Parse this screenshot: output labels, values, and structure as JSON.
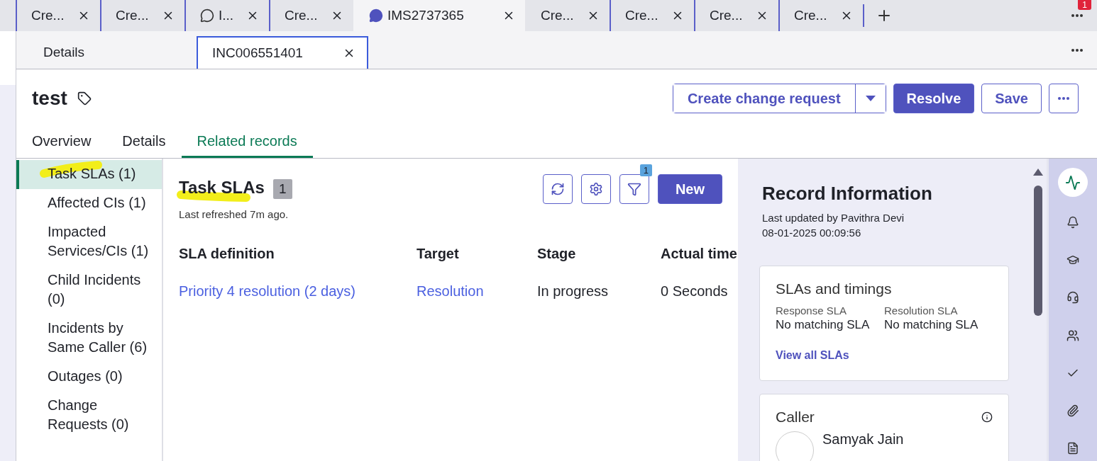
{
  "browser_tabs": [
    {
      "label": "Cre...",
      "kind": "plain",
      "selected": false
    },
    {
      "label": "Cre...",
      "kind": "plain",
      "selected": false
    },
    {
      "label": "I...",
      "kind": "chat",
      "selected": false
    },
    {
      "label": "Cre...",
      "kind": "plain",
      "selected": false
    },
    {
      "label": "IMS2737365",
      "kind": "chat",
      "selected": true
    },
    {
      "label": "Cre...",
      "kind": "plain",
      "selected": false
    },
    {
      "label": "Cre...",
      "kind": "plain",
      "selected": false
    },
    {
      "label": "Cre...",
      "kind": "plain",
      "selected": false
    },
    {
      "label": "Cre...",
      "kind": "plain",
      "selected": false
    }
  ],
  "notification_badge": "1",
  "record_tabs": [
    {
      "label": "Details",
      "selected": false,
      "closable": false
    },
    {
      "label": "INC006551401",
      "selected": true,
      "closable": true
    }
  ],
  "record": {
    "title": "test",
    "actions": [
      {
        "label": "Create change request",
        "kind": "split"
      },
      {
        "label": "Resolve",
        "kind": "primary"
      },
      {
        "label": "Save",
        "kind": "secondary"
      },
      {
        "kind": "more"
      }
    ]
  },
  "tabs": [
    {
      "label": "Overview",
      "selected": false
    },
    {
      "label": "Details",
      "selected": false
    },
    {
      "label": "Related records",
      "selected": true
    }
  ],
  "related_lists": [
    {
      "label": "Task SLAs (1)",
      "selected": true
    },
    {
      "label": "Affected CIs (1)",
      "selected": false
    },
    {
      "label": "Impacted Services/CIs (1)",
      "selected": false
    },
    {
      "label": "Child Incidents (0)",
      "selected": false
    },
    {
      "label": "Incidents by Same Caller (6)",
      "selected": false
    },
    {
      "label": "Outages (0)",
      "selected": false
    },
    {
      "label": "Change Requests (0)",
      "selected": false
    }
  ],
  "task_slas": {
    "title": "Task SLAs",
    "count": "1",
    "refreshed": "Last refreshed 7m ago.",
    "filter_count": "1",
    "new_button": "New",
    "columns": [
      "SLA definition",
      "Target",
      "Stage",
      "Actual time"
    ],
    "rows": [
      {
        "cells": [
          {
            "text": "Priority 4 resolution (2 days)",
            "link": true
          },
          {
            "text": "Resolution",
            "link": true
          },
          {
            "text": "In progress",
            "link": false
          },
          {
            "text": "0 Seconds",
            "link": false
          }
        ]
      }
    ]
  },
  "record_information": {
    "title": "Record Information",
    "updated_by": "Last updated by Pavithra Devi",
    "updated_at": "08-01-2025 00:09:56",
    "slas_card": {
      "title": "SLAs and timings",
      "fields": [
        {
          "label": "Response SLA",
          "value": "No matching SLA"
        },
        {
          "label": "Resolution SLA",
          "value": "No matching SLA"
        }
      ],
      "link": "View all SLAs"
    },
    "caller_card": {
      "title": "Caller",
      "name": "Samyak Jain"
    }
  },
  "rail": [
    {
      "kind": "activity",
      "selected": true
    },
    {
      "kind": "bell",
      "selected": false
    },
    {
      "kind": "cap",
      "selected": false
    },
    {
      "kind": "headset",
      "selected": false
    },
    {
      "kind": "users",
      "selected": false
    },
    {
      "kind": "check",
      "selected": false
    },
    {
      "kind": "clip",
      "selected": false
    },
    {
      "kind": "doc",
      "selected": false
    }
  ]
}
